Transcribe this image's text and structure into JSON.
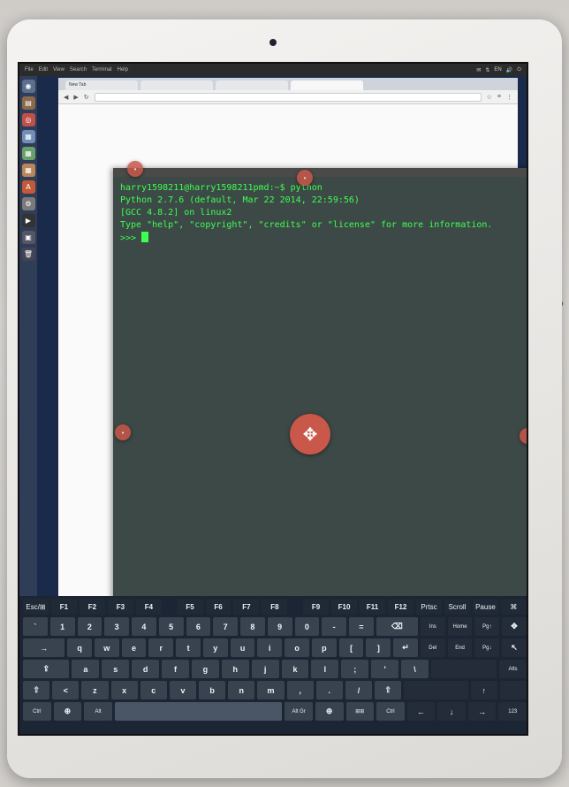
{
  "top_panel": {
    "menu_items": [
      "File",
      "Edit",
      "View",
      "Search",
      "Terminal",
      "Help"
    ],
    "indicators": [
      "✉",
      "⇅",
      "EN",
      "🔊",
      "⏻"
    ]
  },
  "browser": {
    "tabs": [
      "New Tab",
      "",
      "",
      ""
    ],
    "tool_icons": [
      "☆",
      "≡",
      "⋮"
    ]
  },
  "terminal": {
    "title": "",
    "lines": [
      "harry1598211@harry1598211pmd:~$ python",
      "Python 2.7.6 (default, Mar 22 2014, 22:59:56)",
      "[GCC 4.8.2] on linux2",
      "Type \"help\", \"copyright\", \"credits\" or \"license\" for more information.",
      ">>> "
    ]
  },
  "keyboard": {
    "fn_row": [
      "Esc/⊞",
      "F1",
      "F2",
      "F3",
      "F4",
      "F5",
      "F6",
      "F7",
      "F8",
      "F9",
      "F10",
      "F11",
      "F12",
      "Prtsc",
      "Scroll",
      "Pause",
      "⌘"
    ],
    "row1": [
      "`",
      "1",
      "2",
      "3",
      "4",
      "5",
      "6",
      "7",
      "8",
      "9",
      "0",
      "-",
      "=",
      "⌫",
      "Ins",
      "Home",
      "Pg↑",
      "✥"
    ],
    "row2": [
      "→",
      "q",
      "w",
      "e",
      "r",
      "t",
      "y",
      "u",
      "i",
      "o",
      "p",
      "[",
      "]",
      "↵",
      "Del",
      "End",
      "Pg↓",
      "↖"
    ],
    "row3": [
      "⇪",
      "a",
      "s",
      "d",
      "f",
      "g",
      "h",
      "j",
      "k",
      "l",
      ";",
      "'",
      "\\",
      "Alts"
    ],
    "row4": [
      "⇧",
      "<",
      "z",
      "x",
      "c",
      "v",
      "b",
      "n",
      "m",
      ",",
      ".",
      "/",
      "⇧",
      "↑"
    ],
    "row5": [
      "Ctrl",
      "⊕",
      "Alt",
      "",
      "Alt Gr",
      "⊕",
      "⊞⊞",
      "Ctrl",
      "←",
      "↓",
      "→",
      "123"
    ]
  },
  "colors": {
    "terminal_text": "#3dff52",
    "terminal_bg": "#3d4946",
    "fab": "#c9574a",
    "keyboard_bg": "#1c2533"
  }
}
